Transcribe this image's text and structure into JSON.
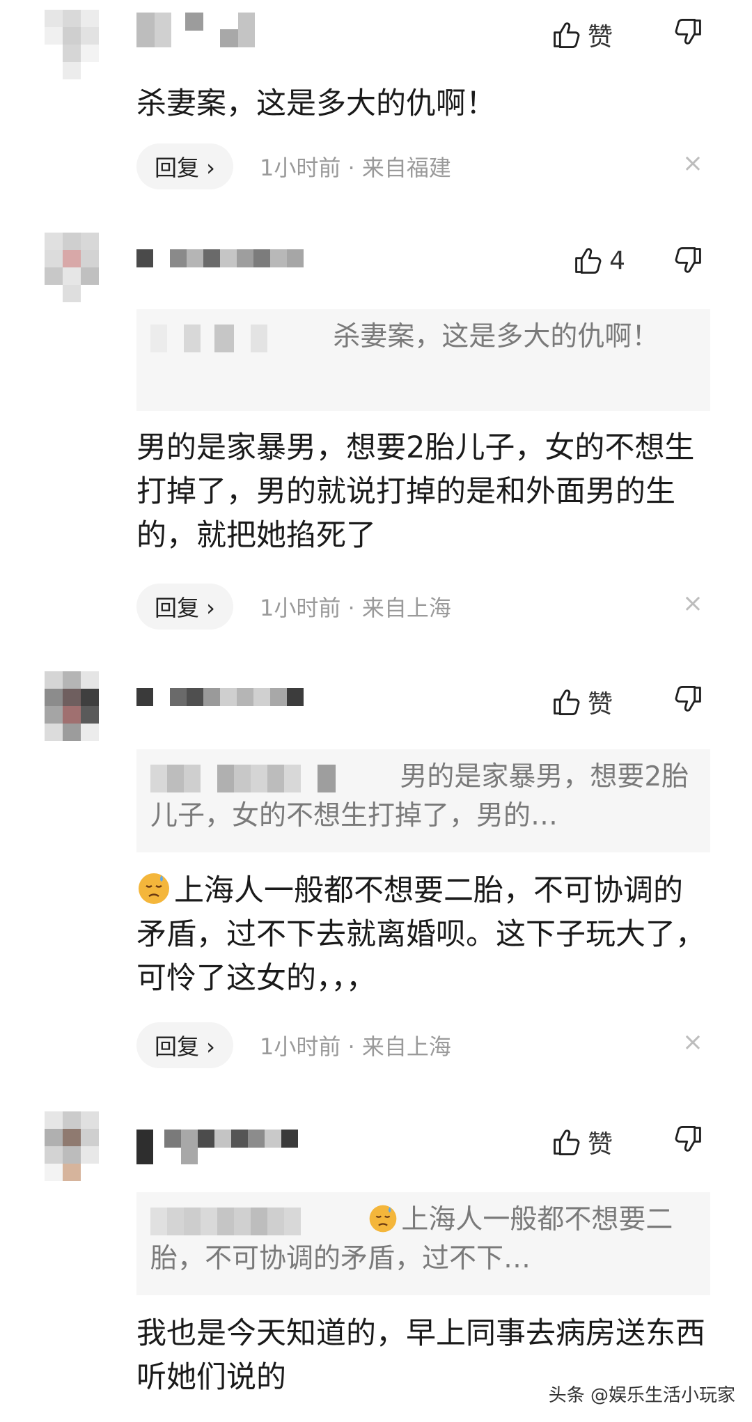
{
  "colors": {
    "text": "#1a1a1a",
    "meta": "#9a9a9a",
    "quote_bg": "#f6f6f6",
    "reply_bg": "#f4f4f4"
  },
  "comments": [
    {
      "like_label": "赞",
      "text": "杀妻案，这是多大的仇啊！",
      "reply_label": "回复 ›",
      "meta": "1小时前 · 来自福建",
      "close": "×"
    },
    {
      "like_label": "4",
      "quote": "杀妻案，这是多大的仇啊！",
      "text": "男的是家暴男，想要2胎儿子，女的不想生打掉了，男的就说打掉的是和外面男的生的，就把她掐死了",
      "reply_label": "回复 ›",
      "meta": "1小时前 · 来自上海",
      "close": "×"
    },
    {
      "like_label": "赞",
      "quote": "男的是家暴男，想要2胎儿子，女的不想生打掉了，男的…",
      "text": "上海人一般都不想要二胎，不可协调的矛盾，过不下去就离婚呗。这下子玩大了，可怜了这女的，，，",
      "reply_label": "回复 ›",
      "meta": "1小时前 · 来自上海",
      "close": "×"
    },
    {
      "like_label": "赞",
      "quote": "上海人一般都不想要二胎，不可协调的矛盾，过不下…",
      "text": "我也是今天知道的，早上同事去病房送东西听她们说的"
    }
  ],
  "icons": {
    "like": "thumbs-up-icon",
    "dislike": "thumbs-down-icon",
    "emoji": "sad-face-emoji-icon"
  },
  "watermark": "头条 @娱乐生活小玩家"
}
